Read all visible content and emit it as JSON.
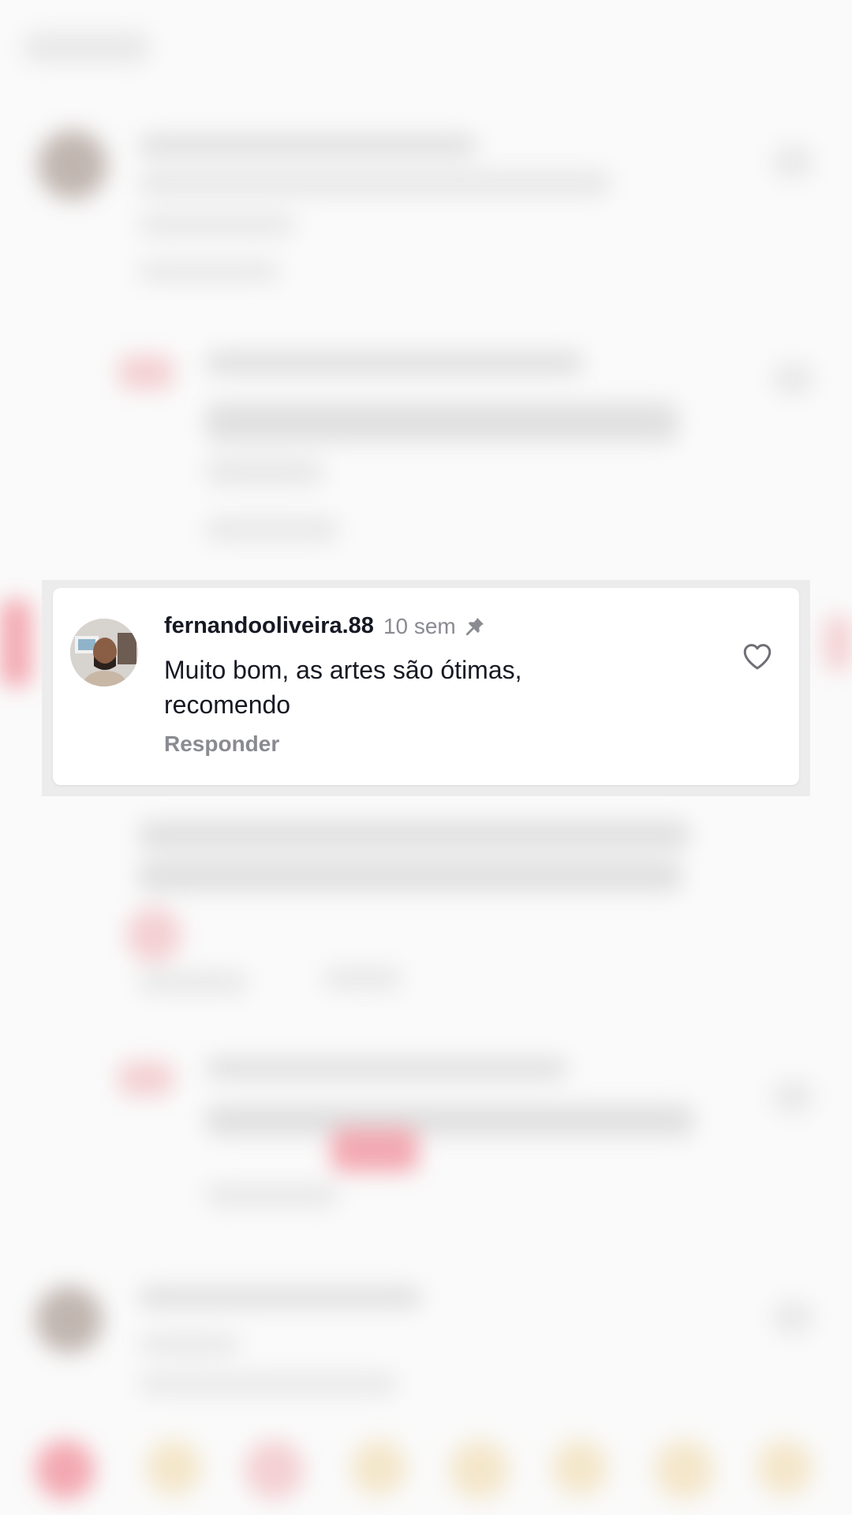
{
  "pinned_comment": {
    "username": "fernandooliveira.88",
    "time_ago": "10 sem",
    "text": "Muito bom, as artes são ótimas, recomendo",
    "reply_label": "Responder",
    "icons": {
      "pin": "pin-icon",
      "like": "heart-outline-icon"
    }
  },
  "colors": {
    "text_primary": "#161823",
    "text_secondary": "#8a8b91",
    "card_background": "#ffffff"
  }
}
